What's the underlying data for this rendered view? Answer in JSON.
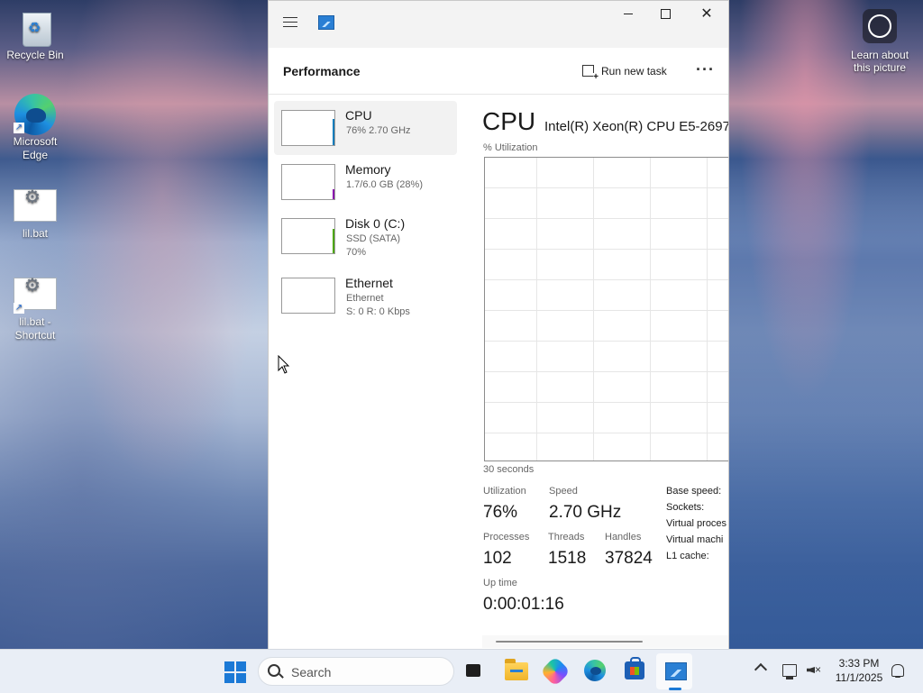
{
  "desktop": {
    "icons": [
      {
        "label": "Recycle Bin"
      },
      {
        "label": "Microsoft Edge"
      },
      {
        "label": "lil.bat"
      },
      {
        "label": "lil.bat - Shortcut"
      }
    ],
    "learn_about": "Learn about this picture"
  },
  "window": {
    "page_title": "Performance",
    "run_new_task": "Run new task",
    "more_glyph": "···",
    "close_glyph": "✕"
  },
  "perf_list": [
    {
      "name": "CPU",
      "sub1": "76% 2.70 GHz",
      "sub2": "",
      "color": "#117dbb",
      "level": 0.76,
      "selected": true
    },
    {
      "name": "Memory",
      "sub1": "1.7/6.0 GB (28%)",
      "sub2": "",
      "color": "#8b12ae",
      "level": 0.28,
      "selected": false
    },
    {
      "name": "Disk 0 (C:)",
      "sub1": "SSD (SATA)",
      "sub2": "70%",
      "color": "#4da60c",
      "level": 0.7,
      "selected": false
    },
    {
      "name": "Ethernet",
      "sub1": "Ethernet",
      "sub2": "S: 0 R: 0 Kbps",
      "color": "#a74f01",
      "level": 0,
      "selected": false
    }
  ],
  "detail": {
    "title": "CPU",
    "model": "Intel(R) Xeon(R) CPU E5-2697",
    "graph_label": "% Utilization",
    "time_label": "30 seconds",
    "stats": {
      "utilization_label": "Utilization",
      "utilization": "76%",
      "speed_label": "Speed",
      "speed": "2.70 GHz",
      "processes_label": "Processes",
      "processes": "102",
      "threads_label": "Threads",
      "threads": "1518",
      "handles_label": "Handles",
      "handles": "37824",
      "uptime_label": "Up time",
      "uptime": "0:00:01:16"
    },
    "right_labels": [
      "Base speed:",
      "Sockets:",
      "Virtual proces",
      "Virtual machi",
      "L1 cache:"
    ]
  },
  "taskbar": {
    "search_placeholder": "Search",
    "time": "3:33 PM",
    "date": "11/1/2025"
  }
}
